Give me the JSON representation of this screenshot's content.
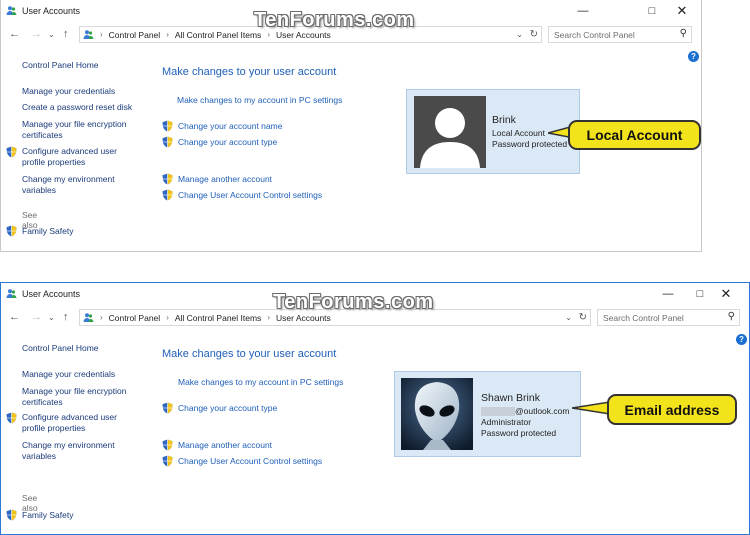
{
  "watermark": "TenForums.com",
  "colors": {
    "accent": "#1f5fb8",
    "card": "#dbe9f6",
    "callout": "#f3e31a",
    "window_border": "#2b79d6"
  },
  "windows": [
    {
      "title": "User Accounts",
      "breadcrumb": [
        "Control Panel",
        "All Control Panel Items",
        "User Accounts"
      ],
      "search_placeholder": "Search Control Panel",
      "sidebar": {
        "home": "Control Panel Home",
        "links": [
          "Manage your credentials",
          "Create a password reset disk",
          "Manage your file encryption certificates",
          "Configure advanced user profile properties",
          "Change my environment variables"
        ],
        "see_also": "See also",
        "family": "Family Safety"
      },
      "main": {
        "title": "Make changes to your user account",
        "pc_settings": "Make changes to my account in PC settings",
        "links": [
          "Change your account name",
          "Change your account type"
        ],
        "links2": [
          "Manage another account",
          "Change User Account Control settings"
        ]
      },
      "account": {
        "name": "Brink",
        "type": "Local Account",
        "status": "Password protected"
      },
      "callout": "Local Account"
    },
    {
      "title": "User Accounts",
      "breadcrumb": [
        "Control Panel",
        "All Control Panel Items",
        "User Accounts"
      ],
      "search_placeholder": "Search Control Panel",
      "sidebar": {
        "home": "Control Panel Home",
        "links": [
          "Manage your credentials",
          "Manage your file encryption certificates",
          "Configure advanced user profile properties",
          "Change my environment variables"
        ],
        "see_also": "See also",
        "family": "Family Safety"
      },
      "main": {
        "title": "Make changes to your user account",
        "pc_settings": "Make changes to my account in PC settings",
        "links": [
          "Change your account type"
        ],
        "links2": [
          "Manage another account",
          "Change User Account Control settings"
        ]
      },
      "account": {
        "name": "Shawn Brink",
        "email": "@outlook.com",
        "role": "Administrator",
        "status": "Password protected"
      },
      "callout": "Email address"
    }
  ]
}
